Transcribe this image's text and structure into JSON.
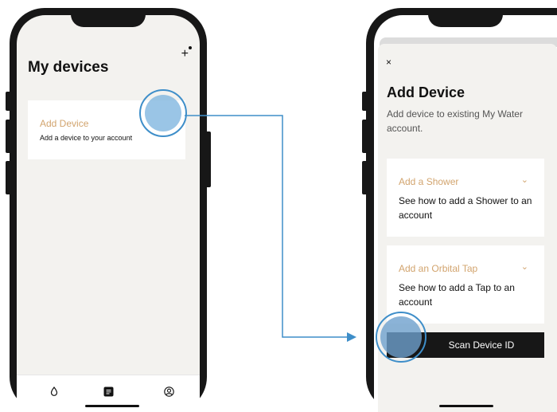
{
  "left_screen": {
    "title": "My devices",
    "add_icon": "+",
    "card": {
      "label": "Add Device",
      "subtitle": "Add a device  to your account"
    },
    "nav": [
      {
        "icon": "water-drop-icon"
      },
      {
        "icon": "document-icon"
      },
      {
        "icon": "profile-icon"
      }
    ]
  },
  "right_screen": {
    "close": "×",
    "title": "Add Device",
    "subtitle": "Add device to existing My Water account.",
    "accordions": [
      {
        "label": "Add a Shower",
        "chevron": "⌄",
        "description": "See how to add a Shower to an account"
      },
      {
        "label": "Add an Orbital Tap",
        "chevron": "⌄",
        "description": "See how to add a Tap to an account"
      }
    ],
    "scan_button": "Scan Device ID"
  },
  "colors": {
    "accent": "#d2a46e",
    "annotation": "#3e8ec9",
    "screen_bg": "#f3f2ef",
    "frame": "#171717"
  }
}
